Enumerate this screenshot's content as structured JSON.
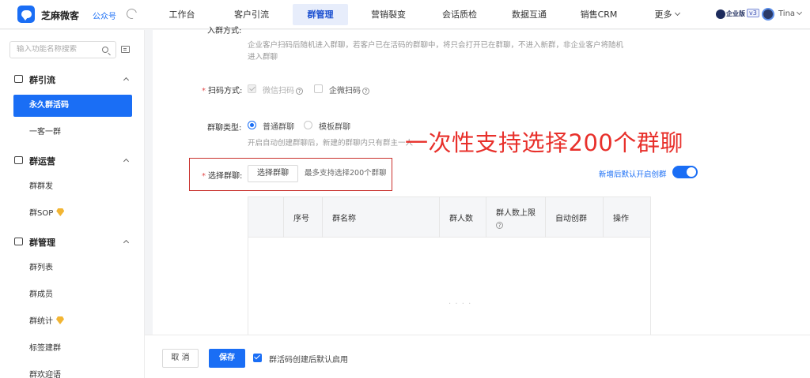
{
  "topbar": {
    "app_name": "芝麻微客",
    "account_type": "公众号",
    "nav": [
      "工作台",
      "客户引流",
      "群管理",
      "营销裂变",
      "会话质检",
      "数据互通",
      "销售CRM",
      "更多"
    ],
    "active_nav": "群管理",
    "edition_label": "企业版",
    "version_badge": "v3",
    "user_name": "Tina"
  },
  "sidebar": {
    "search_placeholder": "输入功能名称搜索",
    "groups": [
      {
        "label": "群引流",
        "items": [
          "永久群活码",
          "一客一群"
        ]
      },
      {
        "label": "群运营",
        "items": [
          "群群发",
          "群SOP"
        ]
      },
      {
        "label": "群管理",
        "items": [
          "群列表",
          "群成员",
          "群统计",
          "标签建群",
          "群欢迎语"
        ]
      }
    ],
    "active_item": "永久群活码"
  },
  "form": {
    "entry_mode_label": "入群方式:",
    "entry_mode_hint_line1": "企业客户扫码后随机进入群聊，若客户已在活码的群聊中，将只会打开已在群聊，不进入新群，非企业客户将随机",
    "entry_mode_hint_line2": "进入群聊",
    "scan_method_label": "扫码方式:",
    "scan_options": [
      "微信扫码",
      "企微扫码"
    ],
    "group_type_label": "群聊类型:",
    "group_type_options": [
      "普通群聊",
      "模板群聊"
    ],
    "group_type_hint": "开启自动创建群聊后，新建的群聊内只有群主一人",
    "select_group_label": "选择群聊:",
    "select_group_button": "选择群聊",
    "select_group_hint": "最多支持选择200个群聊",
    "auto_create_toggle_label": "新增后默认开启创群",
    "auto_create_toggle_on": true
  },
  "annotation": "一次性支持选择200个群聊",
  "table": {
    "columns": [
      "",
      "序号",
      "群名称",
      "群人数",
      "群人数上限",
      "自动创群",
      "操作"
    ],
    "rows": [],
    "empty_text": "· · · ·"
  },
  "footer": {
    "cancel_label": "取 消",
    "save_label": "保存",
    "default_enable_label": "群活码创建后默认启用",
    "default_enable_checked": true
  },
  "colors": {
    "accent": "#1a6ef5",
    "annotation_red": "#e8302b",
    "required_red": "#e34d4d"
  }
}
